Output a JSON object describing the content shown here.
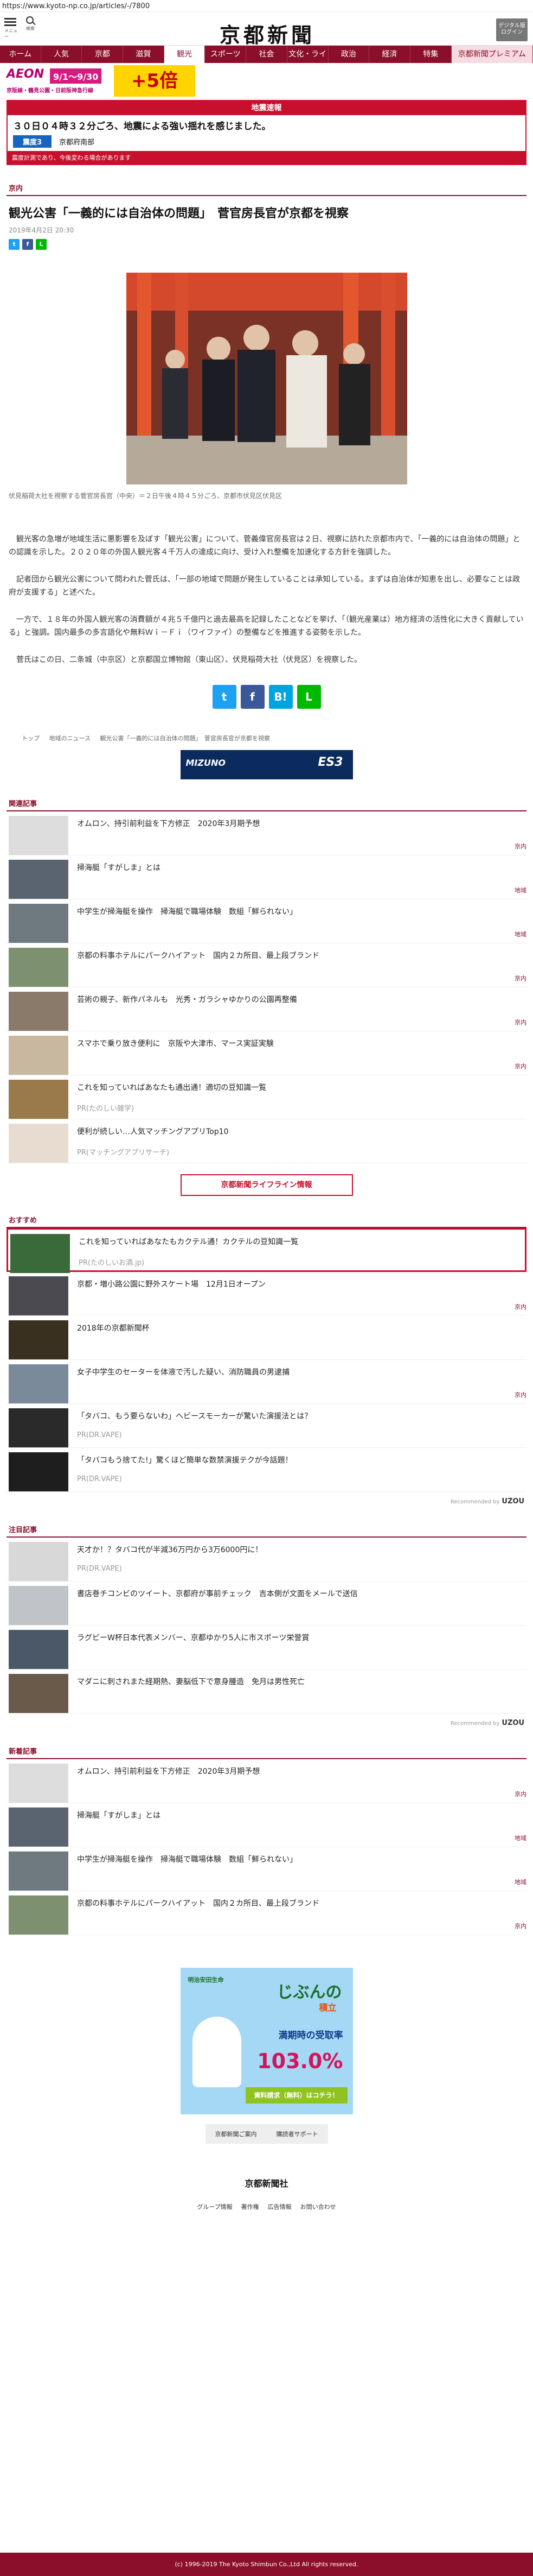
{
  "url": "https://www.kyoto-np.co.jp/articles/-/7800",
  "header": {
    "menu_label": "メニュー",
    "search_label": "検索",
    "logo": "京都新聞",
    "digital_label": "デジタル版ログイン"
  },
  "nav": [
    "ホーム",
    "人気",
    "京都",
    "滋賀",
    "観光",
    "スポーツ",
    "社会",
    "文化・ライフ",
    "政治",
    "経済",
    "特集",
    "京都新聞プレミアム"
  ],
  "ads": {
    "aeon_brand": "AEON",
    "aeon_dates": "9/1〜9/30",
    "aeon_sub": "京阪線・鶴見公園・日前阪神急行線",
    "aeon_points": "+5倍"
  },
  "quake": {
    "head": "地震速報",
    "message": "３０日０４時３２分ごろ、地震による強い揺れを感じました。",
    "badge": "震度3",
    "place": "京都府南部",
    "foot": "震度計測であり、今後変わる場合があります"
  },
  "article": {
    "category": "京内",
    "title": "観光公害「一義的には自治体の問題」　菅官房長官が京都を視察",
    "date": "2019年4月2日 20:30",
    "caption": "伏見稲荷大社を視察する菅官房長官（中央）＝２日午後４時４５分ごろ、京都市伏見区伏見区",
    "paragraphs": [
      "観光客の急増が地域生活に悪影響を及ぼす「観光公害」について、菅義偉官房長官は２日、視察に訪れた京都市内で、「一義的には自治体の問題」との認識を示した。２０２０年の外国人観光客４千万人の達成に向け、受け入れ整備を加速化する方針を強調した。",
      "記者団から観光公害について問われた菅氏は、「一部の地域で問題が発生していることは承知している。まずは自治体が知恵を出し、必要なことは政府が支援する」と述べた。",
      "一方で、１８年の外国人観光客の消費額が４兆５千億円と過去最高を記録したことなどを挙げ、「（観光産業は）地方経済の活性化に大きく貢献している」と強調。国内最多の多言語化や無料Ｗｉ－Ｆｉ（ワイファイ）の整備などを推進する姿勢を示した。",
      "菅氏はこの日、二条城（中京区）と京都国立博物館（東山区）、伏見稲荷大社（伏見区）を視察した。"
    ]
  },
  "share": {
    "tw": "t",
    "fb": "f",
    "hb": "B!",
    "line": "L"
  },
  "breadcrumbs": [
    "トップ",
    "地域のニュース",
    "観光公害「一義的には自治体の問題」　菅官房長官が京都を視察"
  ],
  "mizuno": {
    "brand": "MIZUNO",
    "right": "ES3"
  },
  "related": {
    "heading": "関連記事",
    "items": [
      {
        "title": "オムロン、持引前利益を下方修正　2020年3月期予想",
        "tag": "京内",
        "pr": ""
      },
      {
        "title": "掃海艇「すがしま」とは",
        "tag": "地域",
        "pr": ""
      },
      {
        "title": "中学生が掃海艇を操作　掃海艇で職場体験　数組「鮮られない」",
        "tag": "地域",
        "pr": ""
      },
      {
        "title": "京都の料事ホテルにパークハイアット　国内２カ所目、最上段ブランド",
        "tag": "京内",
        "pr": ""
      },
      {
        "title": "芸術の親子、新作パネルも　光秀・ガラシャゆかりの公園再整備",
        "tag": "京内",
        "pr": ""
      },
      {
        "title": "スマホで乗り放き便利に　京阪や大津市、マース実証実験",
        "tag": "京内",
        "pr": ""
      },
      {
        "title": "これを知っていればあなたも通出通！適切の豆知識一覧",
        "tag": "",
        "pr": "PR(たのしい雑学)"
      },
      {
        "title": "便利が続しい…人気マッチングアプリTop10",
        "tag": "",
        "pr": "PR(マッチングアプリサーチ)"
      }
    ]
  },
  "lifeline": "京都新聞ライフライン情報",
  "recommend": {
    "heading": "おすすめ",
    "items": [
      {
        "title": "これを知っていればあなたもカクテル通！カクテルの豆知識一覧",
        "tag": "",
        "pr": "PR(たのしいお酒.jp)"
      },
      {
        "title": "京都・増小路公園に野外スケート場　12月1日オープン",
        "tag": "京内",
        "pr": ""
      },
      {
        "title": "2018年の京都新聞杯",
        "tag": "",
        "pr": ""
      },
      {
        "title": "女子中学生のセーターを体液で汚した疑い、消防職員の男逮捕",
        "tag": "京内",
        "pr": ""
      },
      {
        "title": "「タバコ、もう要らないわ」ヘビースモーカーが驚いた演援法とは？",
        "tag": "",
        "pr": "PR(DR.VAPE)"
      },
      {
        "title": "「タバコもう捨てた!」驚くほど簡単な数禁演援テクが今話題！",
        "tag": "",
        "pr": "PR(DR.VAPE)"
      }
    ],
    "powered": "Recommended by",
    "uzou": "UZOU"
  },
  "attention": {
    "heading": "注目記事",
    "items": [
      {
        "title": "天才か！？タバコ代が半減36万円から3万6000円に！",
        "tag": "",
        "pr": "PR(DR.VAPE)"
      },
      {
        "title": "書店巻チコンビのツイート、京都府が事前チェック　吉本側が文面をメールで送信",
        "tag": "",
        "pr": ""
      },
      {
        "title": "ラグビーW杯日本代表メンバー、京都ゆかり5人に市スポーツ栄誉賞",
        "tag": "",
        "pr": ""
      },
      {
        "title": "マダニに刺されまた経期熱、妻脳低下で意身腫造　免月は男性死亡",
        "tag": "",
        "pr": ""
      }
    ],
    "powered": "Recommended by",
    "uzou": "UZOU"
  },
  "newest": {
    "heading": "新着記事",
    "items": [
      {
        "title": "オムロン、持引前利益を下方修正　2020年3月期予想",
        "tag": "京内",
        "pr": ""
      },
      {
        "title": "掃海艇「すがしま」とは",
        "tag": "地域",
        "pr": ""
      },
      {
        "title": "中学生が掃海艇を操作　掃海艇で職場体験　数組「鮮られない」",
        "tag": "地域",
        "pr": ""
      },
      {
        "title": "京都の料事ホテルにパークハイアット　国内２カ所目、最上段ブランド",
        "tag": "京内",
        "pr": ""
      }
    ]
  },
  "ad2": {
    "top": "明治安田生命",
    "name": "じぶんの",
    "tag": "積立",
    "lead": "満期時の受取率",
    "pct": "103.0%",
    "cta": "資料請求（無料）はコチラ！"
  },
  "bottom_buttons": [
    "京都新聞ご案内",
    "購読者サポート"
  ],
  "footer": {
    "logo": "京都新聞社",
    "links": [
      "グループ情報",
      "著作権",
      "広告情報",
      "お問い合わせ"
    ],
    "copyright": "(c) 1996-2019 The Kyoto Shimbun Co.,Ltd All rights reserved."
  },
  "colors": {
    "brand": "#8b0f2b",
    "alert": "#c8102e",
    "twitter": "#1da1f2",
    "facebook": "#3b5998",
    "hatena": "#00a4de",
    "line": "#00b900"
  }
}
